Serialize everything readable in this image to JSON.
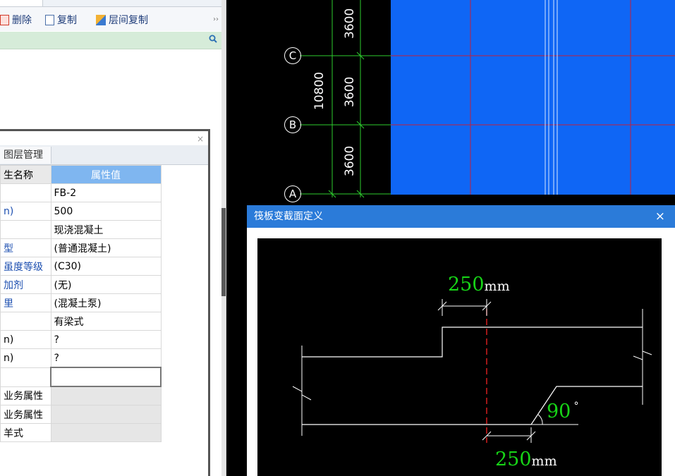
{
  "toolbar": {
    "delete_label": "删除",
    "copy_label": "复制",
    "layer_copy_label": "层间复制",
    "more_label": "››"
  },
  "properties": {
    "tab_label": "图层管理",
    "header_name": "生名称",
    "header_value": "属性值",
    "rows": [
      {
        "name": "",
        "value": "FB-2"
      },
      {
        "name": "n)",
        "value": "500"
      },
      {
        "name": "",
        "value": "现浇混凝土"
      },
      {
        "name": "型",
        "value": "(普通混凝土)"
      },
      {
        "name": "虽度等级",
        "value": "(C30)"
      },
      {
        "name": "加剂",
        "value": "(无)"
      },
      {
        "name": "里",
        "value": "(混凝土泵)"
      },
      {
        "name": "",
        "value": "有梁式"
      },
      {
        "name": "n)",
        "value": "?"
      },
      {
        "name": "n)",
        "value": "?"
      },
      {
        "name": "",
        "value": ""
      },
      {
        "name": "业务属性",
        "value": ""
      },
      {
        "name": "业务属性",
        "value": ""
      },
      {
        "name": "羊式",
        "value": ""
      }
    ]
  },
  "cad": {
    "axes": [
      "C",
      "B",
      "A"
    ],
    "dims": [
      "3600",
      "3600",
      "3600"
    ],
    "total": "10800"
  },
  "dialog": {
    "title": "筏板变截面定义",
    "close": "×",
    "top_value": "250",
    "top_unit": "mm",
    "angle_value": "90",
    "angle_unit": "°",
    "bottom_value": "250",
    "bottom_unit": "mm"
  },
  "colors": {
    "slab_blue": "#0f66f5",
    "grid_green": "#2ecc2e",
    "grid_red": "#c0203a",
    "dim_green": "#17d417",
    "dialog_title": "#2b7bd9"
  }
}
